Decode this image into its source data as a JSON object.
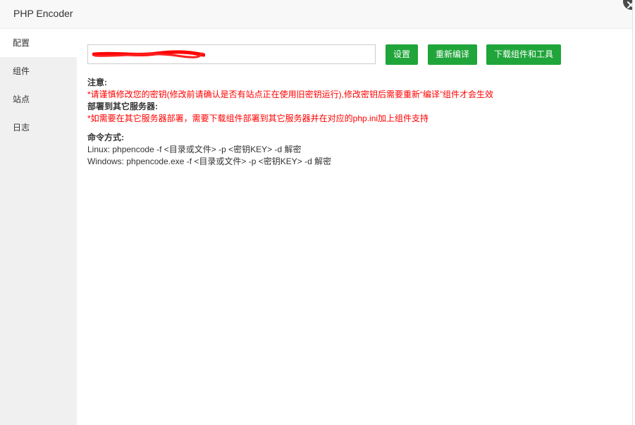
{
  "window": {
    "title": "PHP Encoder"
  },
  "sidebar": {
    "items": [
      {
        "label": "配置"
      },
      {
        "label": "组件"
      },
      {
        "label": "站点"
      },
      {
        "label": "日志"
      }
    ]
  },
  "config": {
    "key_value": "",
    "buttons": {
      "settings": "设置",
      "recompile": "重新编译",
      "download": "下载组件和工具"
    },
    "notice_title": "注意:",
    "notice_text": "*请谨慎修改您的密钥(修改前请确认是否有站点正在使用旧密钥运行),修改密钥后需要重新“编译”组件才会生效",
    "deploy_title": "部署到其它服务器:",
    "deploy_text": "*如需要在其它服务器部署，需要下载组件部署到其它服务器并在对应的php.ini加上组件支持",
    "command_title": "命令方式:",
    "command_linux": "Linux: phpencode -f <目录或文件> -p <密钥KEY> -d 解密",
    "command_windows": "Windows: phpencode.exe -f <目录或文件> -p <密钥KEY> -d 解密"
  },
  "colors": {
    "accent": "#20a53a",
    "warning": "#ff0000",
    "redaction": "#ff0000"
  },
  "icons": {
    "close": "close-icon"
  }
}
